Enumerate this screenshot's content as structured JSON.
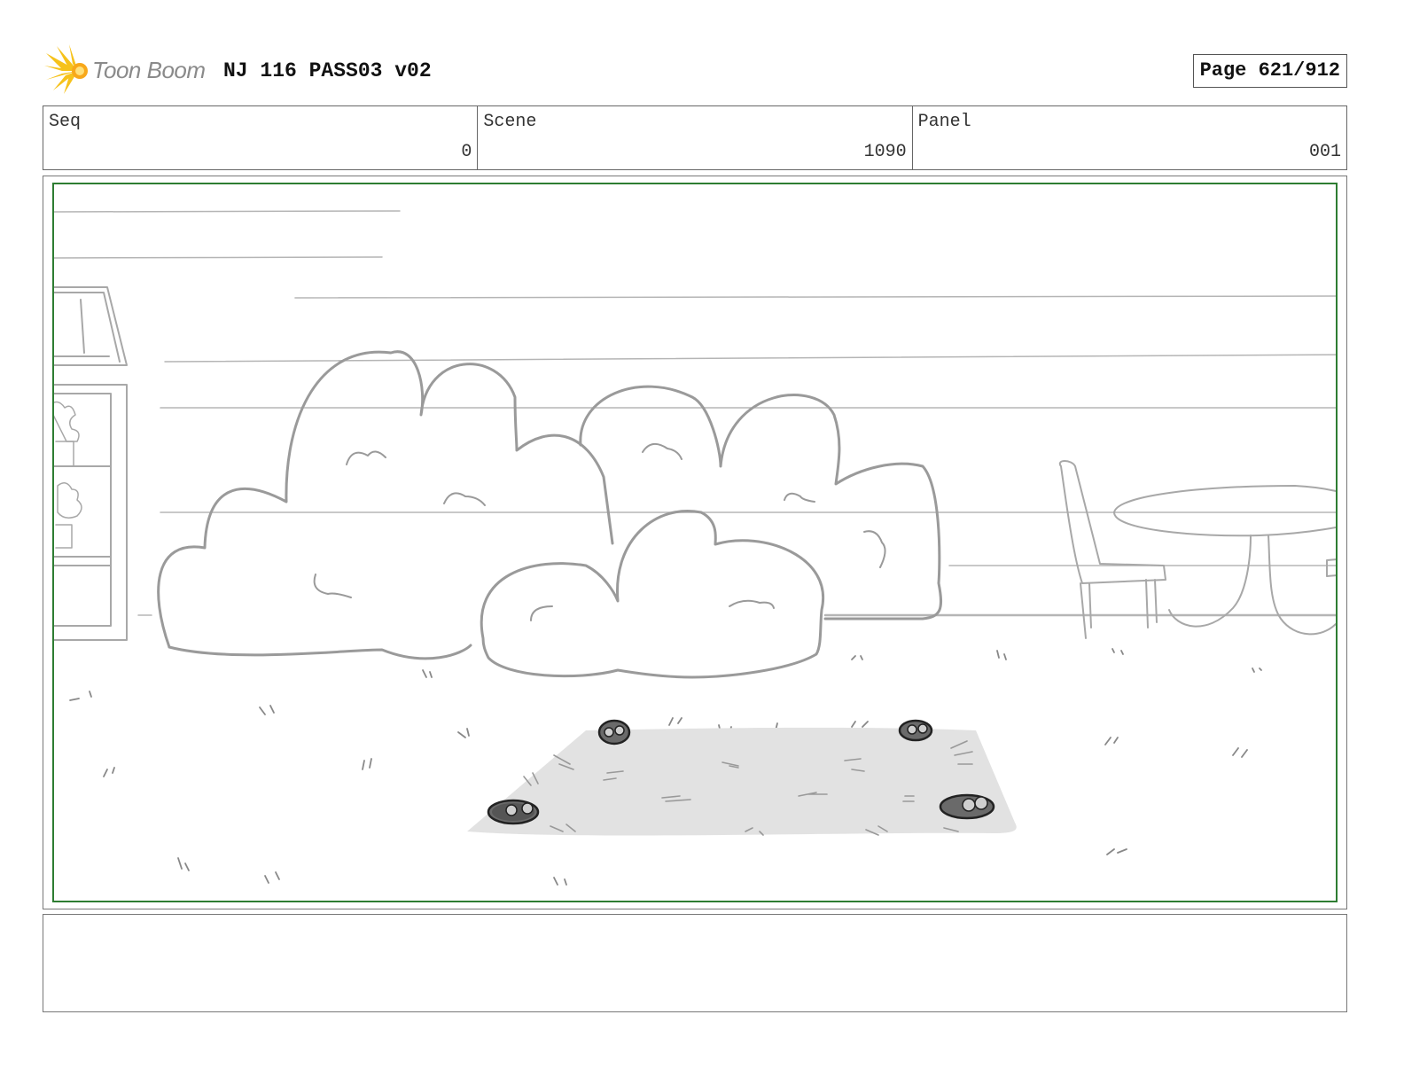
{
  "header": {
    "logo_text": "Toon Boom",
    "title": "NJ 116 PASS03 v02",
    "page_label": "Page 621/912"
  },
  "info": {
    "seq_label": "Seq",
    "seq_value": "0",
    "scene_label": "Scene",
    "scene_value": "1090",
    "panel_label": "Panel",
    "panel_value": "001"
  },
  "colors": {
    "frame_green": "#2e7d32",
    "logo_yellow": "#f6c21b",
    "sketch_gray": "#9a9a9a"
  },
  "notes": {
    "text": ""
  }
}
